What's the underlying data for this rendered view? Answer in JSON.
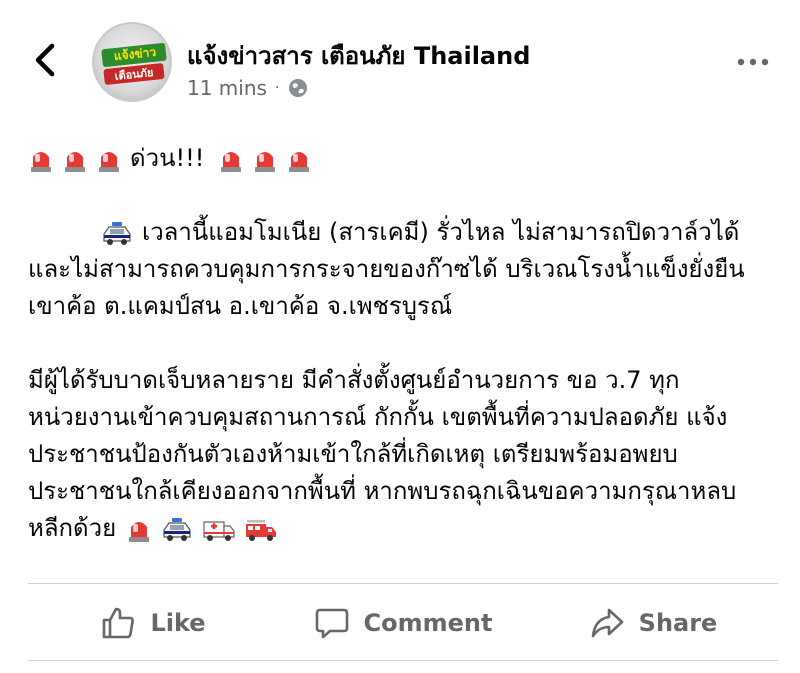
{
  "header": {
    "page_name": "แจ้งข่าวสาร เตือนภัย Thailand",
    "time": "11 mins",
    "separator": "·",
    "avatar_text_top": "แจ้งข่าว",
    "avatar_text_bottom": "เตือนภัย"
  },
  "post": {
    "alert_text": "ด่วน!!!",
    "paragraph1": [
      "เวลานี้แอมโมเนีย (สารเคมี) รั่วไหล ไม่สามารถปิดวาล์วได้",
      "และไม่สามารถควบคุมการกระจายของก๊าซได้ บริเวณโรงน้ำแข็งยั่งยืน",
      "เขาค้อ ต.แคมป์สน อ.เขาค้อ จ.เพชรบูรณ์"
    ],
    "paragraph2": [
      "มีผู้ได้รับบาดเจ็บหลายราย มีคำสั่งตั้งศูนย์อำนวยการ ขอ ว.7 ทุก",
      "หน่วยงานเข้าควบคุมสถานการณ์ กักกั้น เขตพื้นที่ความปลอดภัย แจ้ง",
      "ประชาชนป้องกันตัวเองห้ามเข้าใกล้ที่เกิดเหตุ เตรียมพร้อมอพยบ",
      "ประชาชนใกล้เคียงออกจากพื้นที่ หากพบรถฉุกเฉินขอความกรุณาหลบ",
      "หลีกด้วย"
    ],
    "icons": [
      "police-car-light-icon",
      "police-car-icon",
      "ambulance-icon",
      "fire-engine-icon"
    ]
  },
  "actions": {
    "like": "Like",
    "comment": "Comment",
    "share": "Share"
  },
  "colors": {
    "text": "#050505",
    "secondary": "#65676b",
    "divider": "#ced0d4",
    "siren_red": "#e53935"
  }
}
